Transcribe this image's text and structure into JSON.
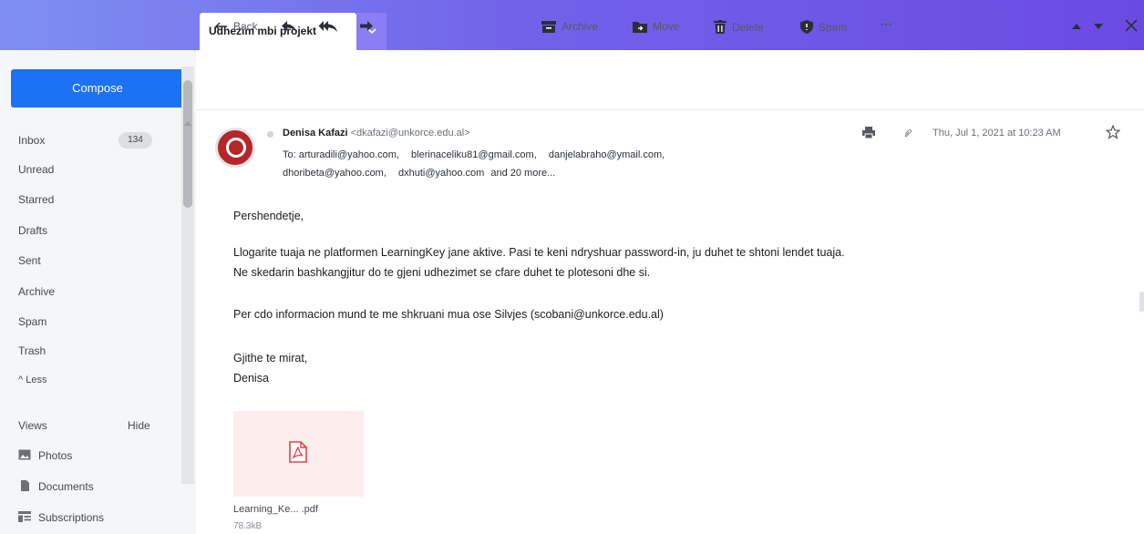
{
  "tab": {
    "title": "Udhezim mbi projekt"
  },
  "sidebar": {
    "compose": "Compose",
    "folders": [
      {
        "label": "Inbox",
        "count": "134"
      },
      {
        "label": "Unread"
      },
      {
        "label": "Starred"
      },
      {
        "label": "Drafts"
      },
      {
        "label": "Sent"
      },
      {
        "label": "Archive"
      },
      {
        "label": "Spam"
      },
      {
        "label": "Trash"
      },
      {
        "label": "^ Less"
      }
    ],
    "views_title": "Views",
    "views_hide": "Hide",
    "views": [
      {
        "label": "Photos",
        "icon": "photo-icon"
      },
      {
        "label": "Documents",
        "icon": "document-icon"
      },
      {
        "label": "Subscriptions",
        "icon": "subscriptions-icon"
      }
    ]
  },
  "toolbar": {
    "back": "Back",
    "archive": "Archive",
    "move": "Move",
    "delete": "Delete",
    "spam": "Spam",
    "more": "•••"
  },
  "message": {
    "sender_name": "Denisa Kafazi",
    "sender_email": "<dkafazi@unkorce.edu.al>",
    "to_label": "To:",
    "recipients": [
      "arturadili@yahoo.com,",
      "blerinaceliku81@gmail.com,",
      "danjelabraho@ymail.com,",
      "dhoribeta@yahoo.com,",
      "dxhuti@yahoo.com"
    ],
    "more_recipients": "and 20 more...",
    "date": "Thu, Jul 1, 2021 at 10:23 AM",
    "body": {
      "greeting": "Pershendetje,",
      "line1": "Llogarite tuaja ne platformen LearningKey jane aktive. Pasi te keni ndryshuar password-in, ju duhet te shtoni lendet tuaja.",
      "line2": "Ne skedarin bashkangjitur do te gjeni udhezimet se cfare duhet te plotesoni dhe si.",
      "line3": "Per cdo informacion mund te me shkruani mua ose Silvjes (scobani@unkorce.edu.al)",
      "closing": "Gjithe te mirat,",
      "signature": "Denisa"
    },
    "attachment": {
      "name": "Learning_Ke... .pdf",
      "size": "78.3kB"
    }
  },
  "colors": {
    "accent": "#1d72f3",
    "header": "#7163ea",
    "pdf": "#e5424d"
  }
}
